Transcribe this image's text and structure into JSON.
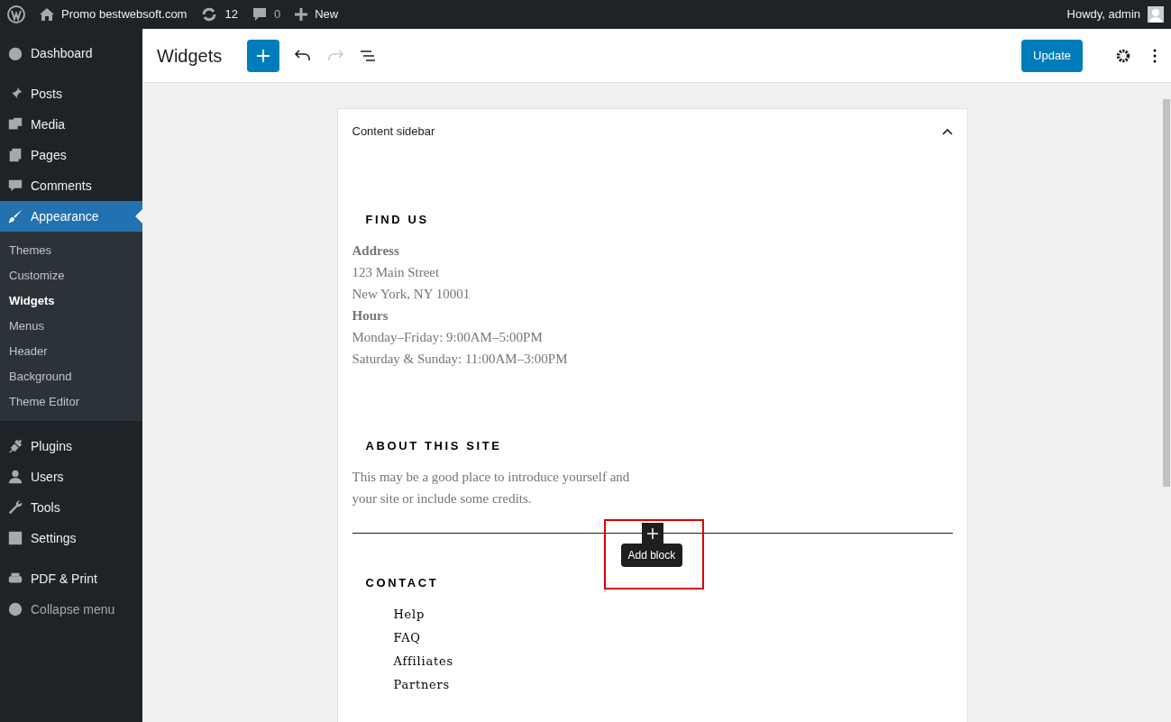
{
  "admin_bar": {
    "site": "Promo bestwebsoft.com",
    "updates": "12",
    "comments": "0",
    "new": "New",
    "greeting": "Howdy, admin"
  },
  "sidebar": {
    "items": [
      {
        "label": "Dashboard",
        "selected": false
      },
      {
        "label": "Posts",
        "selected": false
      },
      {
        "label": "Media",
        "selected": false
      },
      {
        "label": "Pages",
        "selected": false
      },
      {
        "label": "Comments",
        "selected": false
      },
      {
        "label": "Appearance",
        "selected": true,
        "children": [
          {
            "label": "Themes",
            "selected": false
          },
          {
            "label": "Customize",
            "selected": false
          },
          {
            "label": "Widgets",
            "selected": true
          },
          {
            "label": "Menus",
            "selected": false
          },
          {
            "label": "Header",
            "selected": false
          },
          {
            "label": "Background",
            "selected": false
          },
          {
            "label": "Theme Editor",
            "selected": false
          }
        ]
      },
      {
        "label": "Plugins",
        "selected": false
      },
      {
        "label": "Users",
        "selected": false
      },
      {
        "label": "Tools",
        "selected": false
      },
      {
        "label": "Settings",
        "selected": false
      },
      {
        "label": "PDF & Print",
        "selected": false
      },
      {
        "label": "Collapse menu",
        "selected": false
      }
    ]
  },
  "editor": {
    "title": "Widgets",
    "update_button": "Update"
  },
  "widget_area": {
    "title": "Content sidebar",
    "expanded": true,
    "blocks": [
      {
        "heading": "FIND US",
        "lines": [
          {
            "kind": "label",
            "text": "Address"
          },
          {
            "kind": "text",
            "text": "123 Main Street"
          },
          {
            "kind": "text",
            "text": "New York, NY 10001"
          },
          {
            "kind": "label",
            "text": "Hours"
          },
          {
            "kind": "text",
            "text": "Monday–Friday: 9:00AM–5:00PM"
          },
          {
            "kind": "text",
            "text": "Saturday & Sunday: 11:00AM–3:00PM"
          }
        ]
      },
      {
        "heading": "ABOUT THIS SITE",
        "lines": [
          {
            "kind": "text",
            "text": "This may be a good place to introduce yourself and your site or include some credits."
          }
        ]
      },
      {
        "heading": "CONTACT",
        "lines": [
          {
            "kind": "link",
            "text": "Help"
          },
          {
            "kind": "link",
            "text": "FAQ"
          },
          {
            "kind": "link",
            "text": "Affiliates"
          },
          {
            "kind": "link",
            "text": "Partners"
          }
        ]
      }
    ],
    "inserter_tooltip": "Add block"
  }
}
